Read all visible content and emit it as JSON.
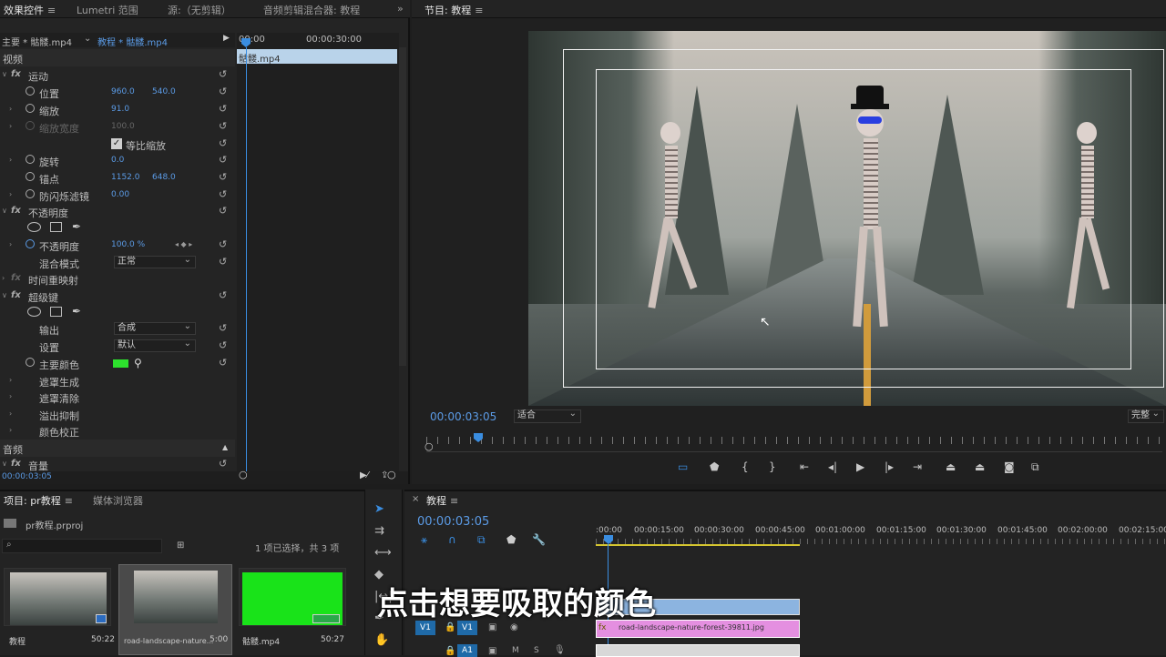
{
  "effect_controls": {
    "tabs": [
      "效果控件",
      "Lumetri 范围",
      "源:（无剪辑）",
      "音频剪辑混合器: 教程"
    ],
    "master": "主要 * 骷髅.mp4",
    "sequence_clip": "教程 * 骷髅.mp4",
    "ruler": [
      "00:00",
      "00:00:30:00"
    ],
    "clip_label": "骷髅.mp4",
    "video_header": "视频",
    "rows": {
      "motion": "运动",
      "position": "位置",
      "position_x": "960.0",
      "position_y": "540.0",
      "scale": "缩放",
      "scale_val": "91.0",
      "scale_width": "缩放宽度",
      "scale_width_val": "100.0",
      "uniform": "等比缩放",
      "rotation": "旋转",
      "rotation_val": "0.0",
      "anchor": "锚点",
      "anchor_x": "1152.0",
      "anchor_y": "648.0",
      "antiflicker": "防闪烁滤镜",
      "antiflicker_val": "0.00",
      "opacity_group": "不透明度",
      "opacity": "不透明度",
      "opacity_val": "100.0 %",
      "blend": "混合模式",
      "blend_val": "正常",
      "time_remap": "时间重映射",
      "ultra_key": "超级键",
      "output": "输出",
      "output_val": "合成",
      "setting": "设置",
      "setting_val": "默认",
      "key_color": "主要颜色",
      "matte_gen": "遮罩生成",
      "matte_clean": "遮罩清除",
      "spill": "溢出抑制",
      "color_correct": "颜色校正",
      "audio_header": "音频",
      "volume": "音量"
    },
    "key_color_hex": "#2de22d",
    "time": "00:00:03:05"
  },
  "program": {
    "title": "节目: 教程",
    "timecode": "00:00:03:05",
    "fit": "适合",
    "quality": "完整"
  },
  "project": {
    "tabs": [
      "项目: pr教程",
      "媒体浏览器"
    ],
    "file": "pr教程.prproj",
    "selection": "1 项已选择，共 3 项",
    "items": [
      {
        "name": "教程",
        "duration": "50:22"
      },
      {
        "name": "road-landscape-nature...",
        "duration": "5:00"
      },
      {
        "name": "骷髅.mp4",
        "duration": "50:27"
      }
    ]
  },
  "timeline": {
    "title": "教程",
    "timecode": "00:00:03:05",
    "ruler": [
      ":00:00",
      "00:00:15:00",
      "00:00:30:00",
      "00:00:45:00",
      "00:01:00:00",
      "00:01:15:00",
      "00:01:30:00",
      "00:01:45:00",
      "00:02:00:00",
      "00:02:15:00"
    ],
    "v1": "V1",
    "a1": "A1",
    "clip_name": "road-landscape-nature-forest-39811.jpg",
    "caption": "点击想要吸取的颜色"
  }
}
